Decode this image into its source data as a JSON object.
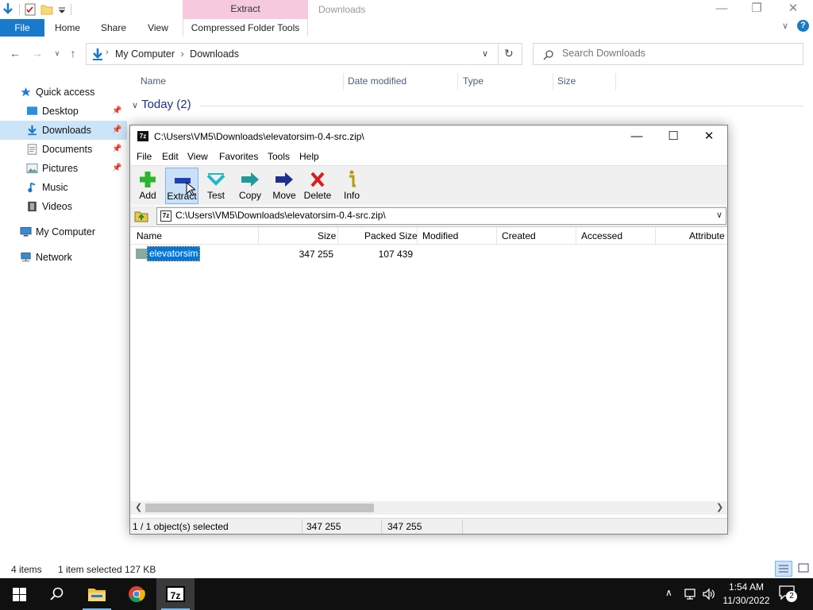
{
  "explorer": {
    "context_tab": "Extract",
    "title": "Downloads",
    "ribbon_tabs": [
      "File",
      "Home",
      "Share",
      "View",
      "Compressed Folder Tools"
    ],
    "breadcrumbs": [
      "My Computer",
      "Downloads"
    ],
    "search_placeholder": "Search Downloads",
    "sidebar": [
      {
        "label": "Quick access",
        "icon": "star-icon"
      },
      {
        "label": "Desktop",
        "icon": "desktop-icon",
        "pinned": true
      },
      {
        "label": "Downloads",
        "icon": "download-icon",
        "pinned": true,
        "selected": true
      },
      {
        "label": "Documents",
        "icon": "documents-icon",
        "pinned": true
      },
      {
        "label": "Pictures",
        "icon": "pictures-icon",
        "pinned": true
      },
      {
        "label": "Music",
        "icon": "music-icon"
      },
      {
        "label": "Videos",
        "icon": "videos-icon"
      },
      {
        "label": "My Computer",
        "icon": "computer-icon"
      },
      {
        "label": "Network",
        "icon": "network-icon"
      }
    ],
    "columns": [
      "Name",
      "Date modified",
      "Type",
      "Size"
    ],
    "group_label": "Today (2)",
    "status": {
      "items": "4 items",
      "selected": "1 item selected  127 KB"
    }
  },
  "sevenzip": {
    "title": "C:\\Users\\VM5\\Downloads\\elevatorsim-0.4-src.zip\\",
    "menu": [
      "File",
      "Edit",
      "View",
      "Favorites",
      "Tools",
      "Help"
    ],
    "toolbar": [
      "Add",
      "Extract",
      "Test",
      "Copy",
      "Move",
      "Delete",
      "Info"
    ],
    "path": "C:\\Users\\VM5\\Downloads\\elevatorsim-0.4-src.zip\\",
    "columns": [
      "Name",
      "Size",
      "Packed Size",
      "Modified",
      "Created",
      "Accessed",
      "Attribute"
    ],
    "rows": [
      {
        "name": "elevatorsim",
        "size": "347 255",
        "packed": "107 439"
      }
    ],
    "status": {
      "selection": "1 / 1 object(s) selected",
      "size": "347 255",
      "packed": "347 255"
    }
  },
  "taskbar": {
    "time": "1:54 AM",
    "date": "11/30/2022",
    "notifications": "2"
  },
  "colors": {
    "accent": "#0078d7",
    "file_tab": "#1979ca",
    "context_tab": "#f6c9de",
    "taskbar": "#101010"
  }
}
